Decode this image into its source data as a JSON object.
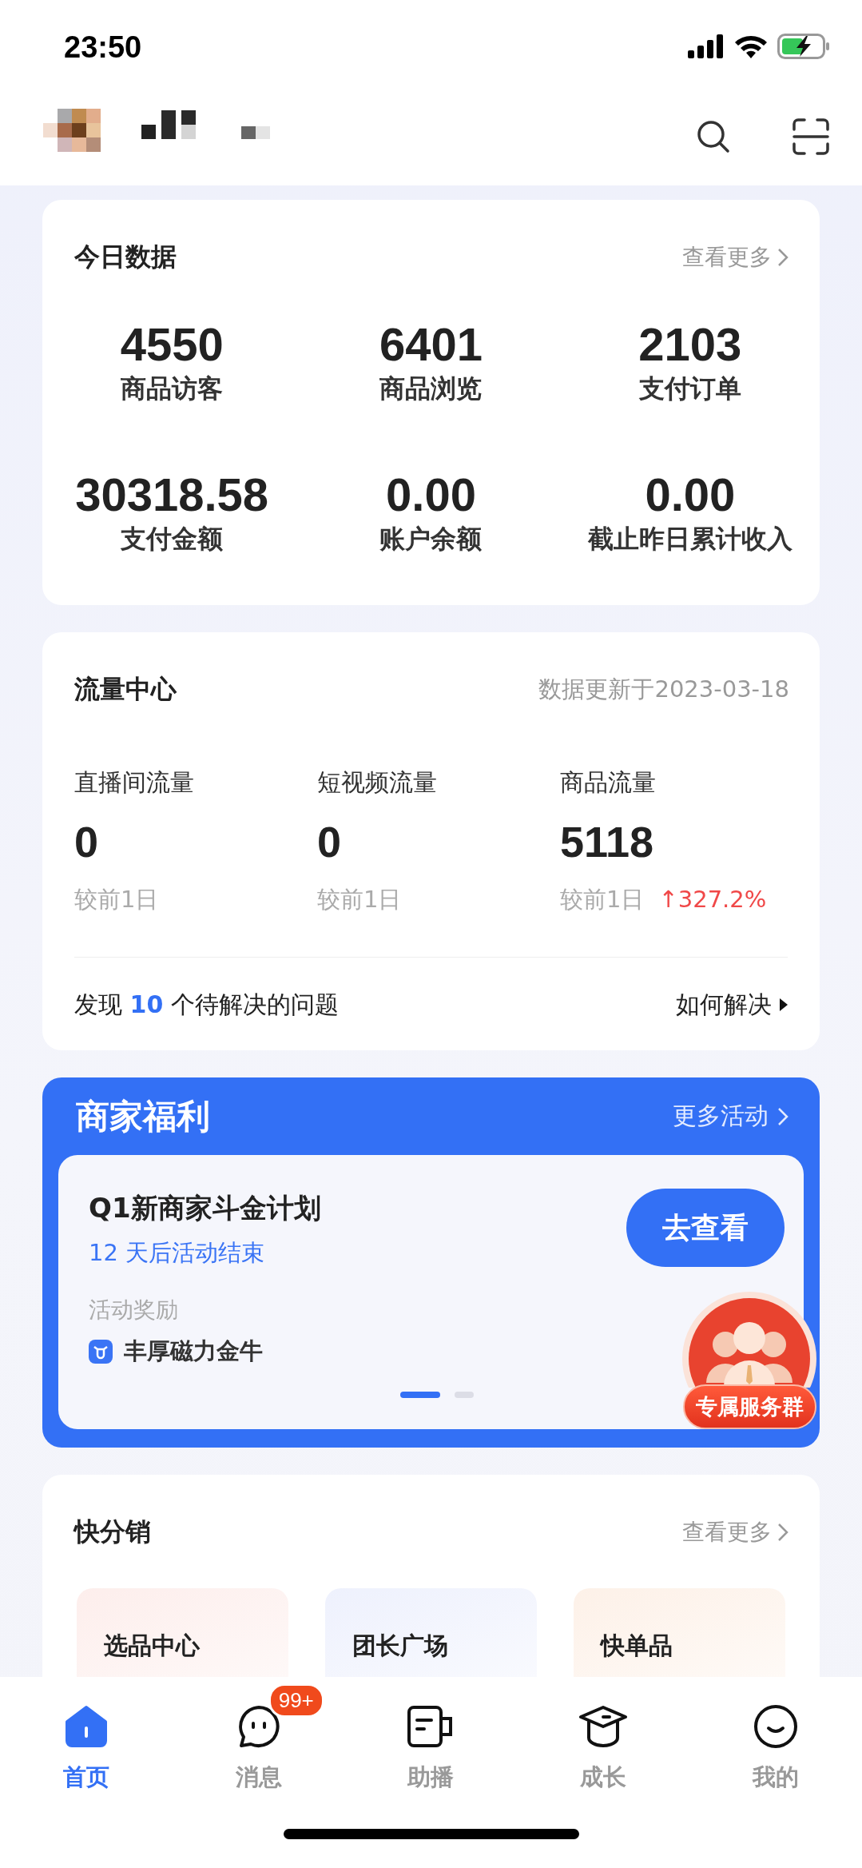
{
  "status_bar": {
    "time": "23:50"
  },
  "today_data": {
    "title": "今日数据",
    "more": "查看更多",
    "metrics": [
      {
        "value": "4550",
        "label": "商品访客"
      },
      {
        "value": "6401",
        "label": "商品浏览"
      },
      {
        "value": "2103",
        "label": "支付订单"
      },
      {
        "value": "30318.58",
        "label": "支付金额"
      },
      {
        "value": "0.00",
        "label": "账户余额"
      },
      {
        "value": "0.00",
        "label": "截止昨日累计收入"
      }
    ]
  },
  "traffic_center": {
    "title": "流量中心",
    "updated": "数据更新于2023-03-18",
    "metrics": [
      {
        "label": "直播间流量",
        "value": "0",
        "compare": "较前1日"
      },
      {
        "label": "短视频流量",
        "value": "0",
        "compare": "较前1日"
      },
      {
        "label": "商品流量",
        "value": "5118",
        "compare": "较前1日",
        "change": "↑327.2%"
      }
    ],
    "issues": {
      "prefix": "发现",
      "count": "10",
      "suffix": "个待解决的问题"
    },
    "how_to": "如何解决"
  },
  "merchant_welfare": {
    "title": "商家福利",
    "more": "更多活动",
    "campaign": {
      "title": "Q1新商家斗金计划",
      "countdown": "12 天后活动结束",
      "reward_label": "活动奖励",
      "reward": "丰厚磁力金牛",
      "button": "去查看"
    },
    "pages": [
      {
        "selected": true
      },
      {
        "selected": false
      }
    ]
  },
  "service_badge": {
    "label": "专属服务群"
  },
  "distribution": {
    "title": "快分销",
    "more": "查看更多",
    "cards": [
      {
        "title": "选品中心",
        "color": "#fdeeec"
      },
      {
        "title": "团长广场",
        "color": "#eef1fd"
      },
      {
        "title": "快单品",
        "color": "#fdf1e8"
      }
    ]
  },
  "tab_bar": [
    {
      "kind": "home",
      "label": "首页",
      "selected": true
    },
    {
      "kind": "chat",
      "label": "消息",
      "selected": false,
      "badge": "99+"
    },
    {
      "kind": "broadcast",
      "label": "助播",
      "selected": false
    },
    {
      "kind": "growth",
      "label": "成长",
      "selected": false
    },
    {
      "kind": "me",
      "label": "我的",
      "selected": false
    }
  ]
}
